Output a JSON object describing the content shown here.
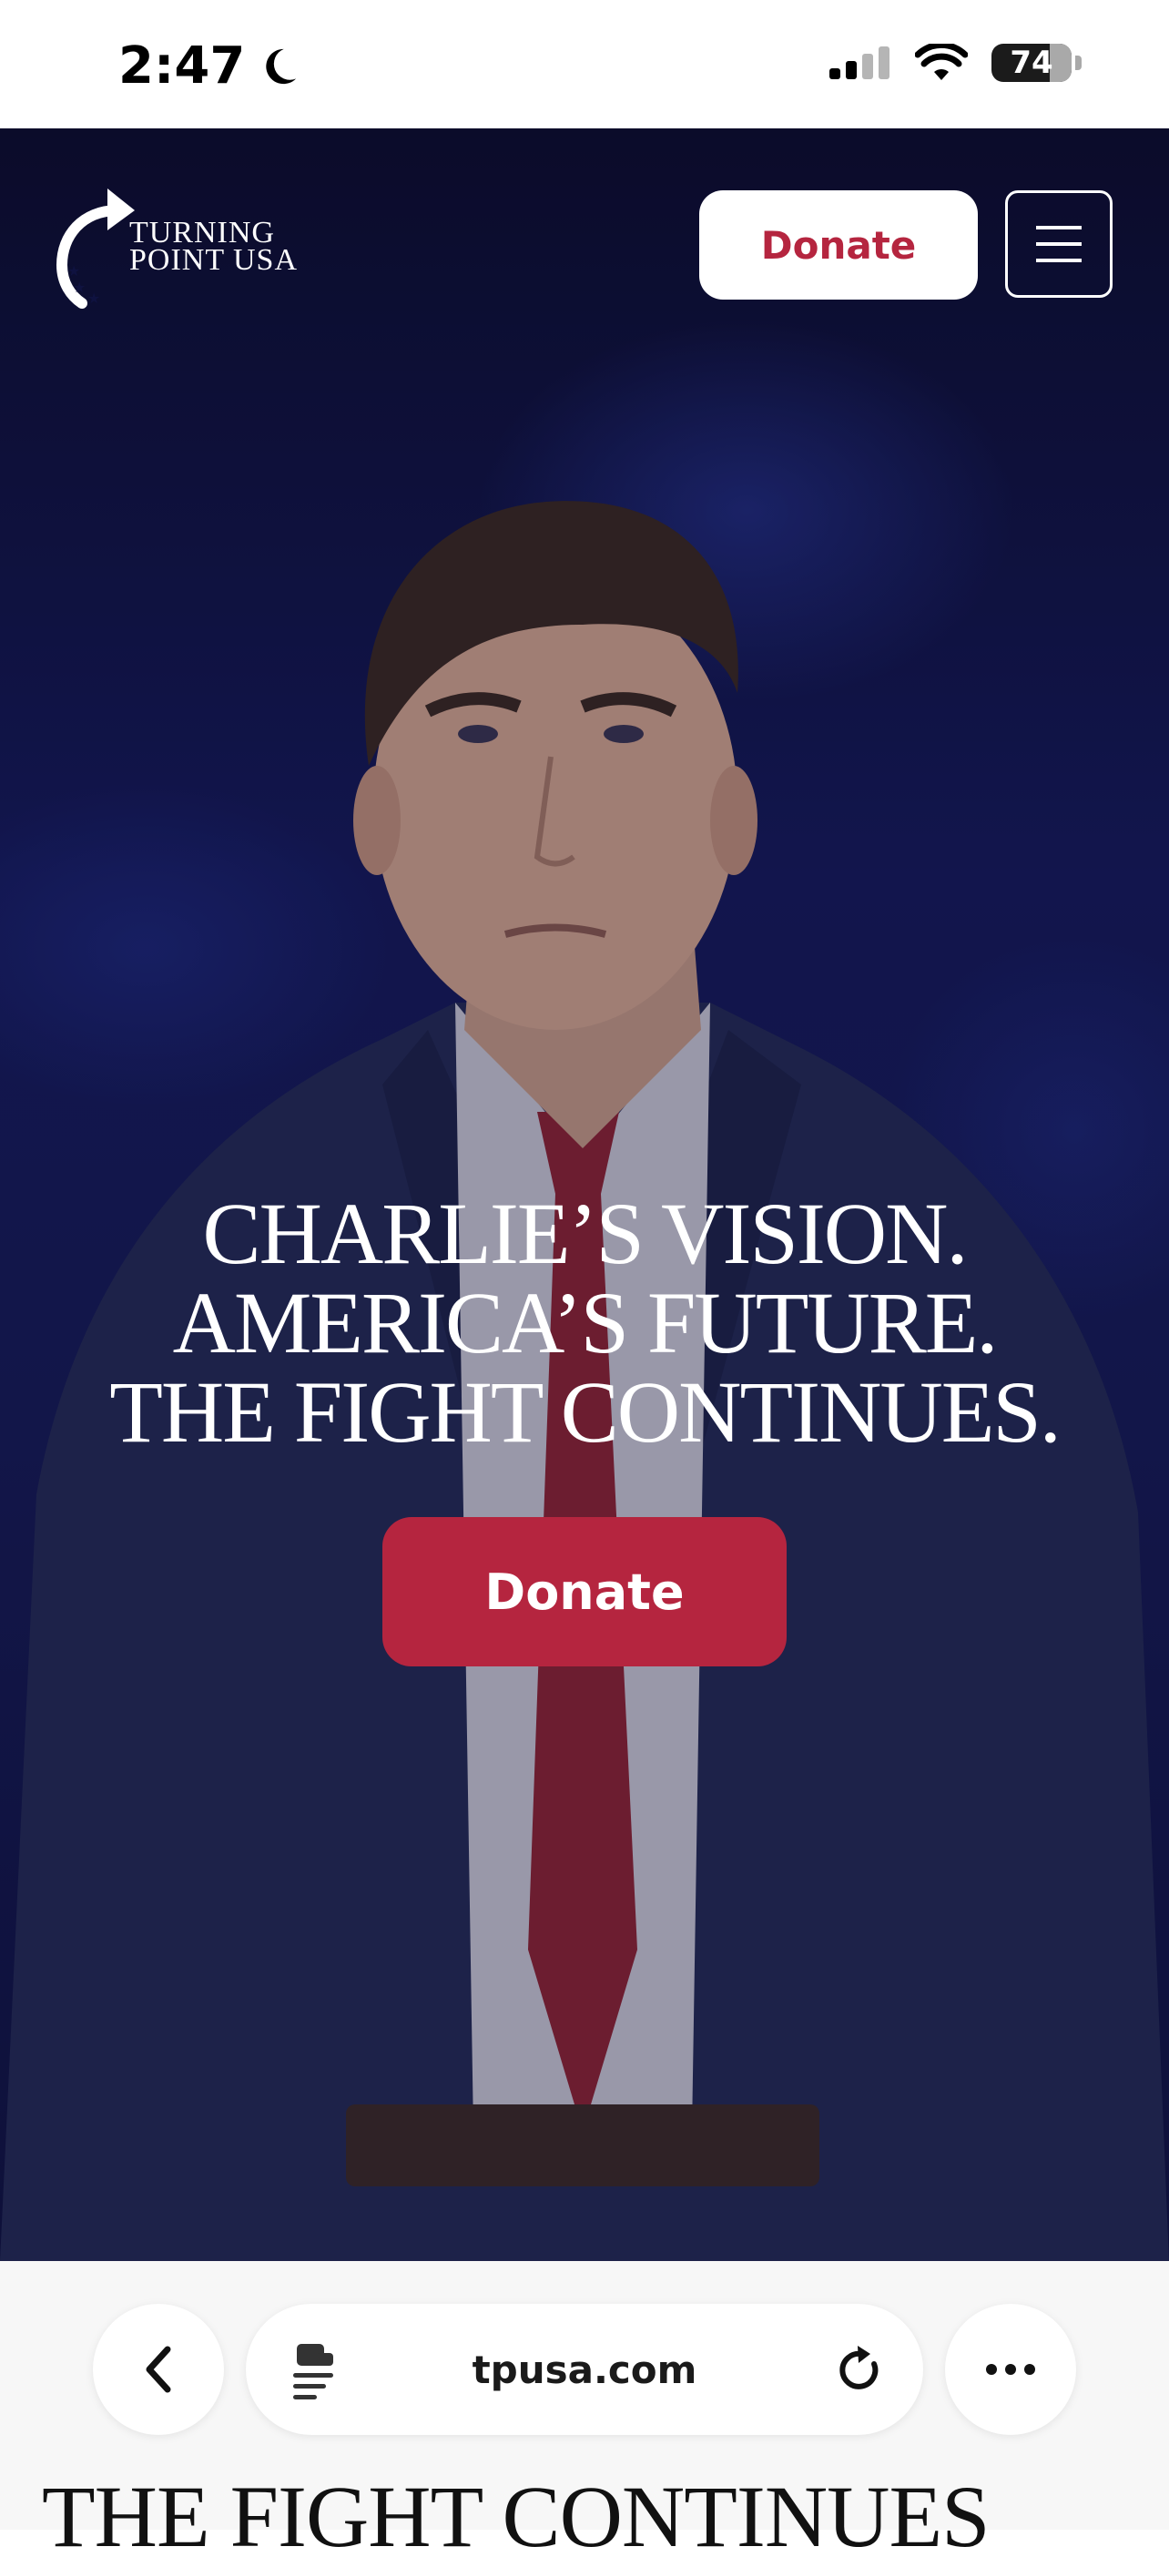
{
  "status_bar": {
    "time": "2:47",
    "battery_level": "74"
  },
  "header": {
    "logo_line1": "TURNING",
    "logo_line2": "POINT USA",
    "donate_label": "Donate"
  },
  "hero": {
    "heading_lines": [
      "CHARLIE’S VISION.",
      "AMERICA’S FUTURE.",
      "THE FIGHT CONTINUES."
    ],
    "donate_label": "Donate"
  },
  "browser": {
    "url": "tpusa.com"
  },
  "next_section": {
    "heading": "THE FIGHT CONTINUES"
  },
  "colors": {
    "brand_red": "#b5253f",
    "hero_navy": "#14195a"
  }
}
